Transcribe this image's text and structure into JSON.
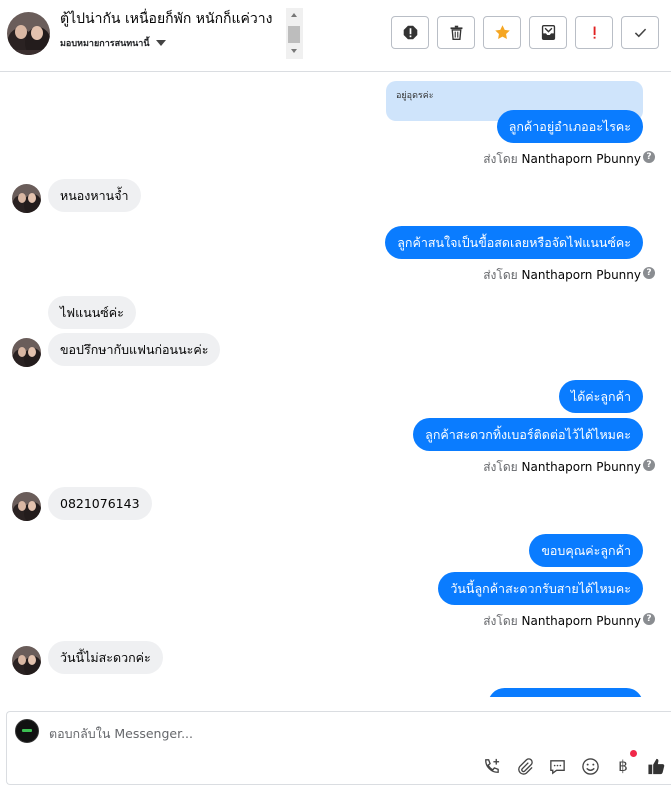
{
  "header": {
    "title": "ตู้ไปน่ากัน เหนื่อยก็พัก หนักก็แค่วาง",
    "subtitle": "มอบหมายการสนทนานี้"
  },
  "toolbar": [
    "spam-icon",
    "trash-icon",
    "star-icon",
    "archive-icon",
    "exclamation-icon",
    "check-icon"
  ],
  "conversation": {
    "quote": "อยู่อุดรค่ะ",
    "messages": [
      {
        "side": "out",
        "text": "ลูกค้าอยู่อำเภออะไรคะ"
      },
      {
        "side": "in",
        "text": "หนองหานจ้ำ"
      },
      {
        "side": "out",
        "text": "ลูกค้าสนใจเป็นขื้อสดเลยหรือจัดไฟแนนซ์คะ"
      },
      {
        "side": "in",
        "text": "ไฟแนนซ์ค่ะ"
      },
      {
        "side": "in",
        "text": "ขอปรึกษากับแฟนก่อนนะค่ะ"
      },
      {
        "side": "out",
        "text": "ได้ค่ะลูกค้า"
      },
      {
        "side": "out",
        "text": "ลูกค้าสะดวกทิ้งเบอร์ติดต่อไว้ได้ไหมคะ"
      },
      {
        "side": "in",
        "text": "0821076143"
      },
      {
        "side": "out",
        "text": "ขอบคุณค่ะลูกค้า"
      },
      {
        "side": "out",
        "text": "วันนี้ลูกค้าสะดวกรับสายได้ไหมคะ"
      },
      {
        "side": "in",
        "text": "วันนี้ไม่สะดวกค่ะ"
      }
    ],
    "sent_by_prefix": "ส่งโดย",
    "sender_name": "Nanthaporn Pbunny",
    "help_glyph": "?"
  },
  "composer": {
    "placeholder": "ตอบกลับใน Messenger...",
    "baht_symbol": "฿",
    "tools": [
      "call-add-icon",
      "attach-icon",
      "saved-reply-icon",
      "emoji-icon",
      "payment-icon",
      "like-icon"
    ]
  },
  "colors": {
    "outgoing_bubble": "#0a7cff",
    "incoming_bubble": "#eff0f2",
    "quote_bubble": "#cfe4fb",
    "star": "#f5a623",
    "warning": "#e02020"
  }
}
